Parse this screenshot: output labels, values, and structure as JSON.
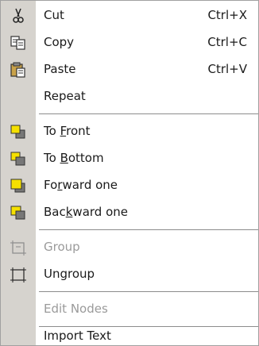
{
  "menu": {
    "items": [
      {
        "label": "Cut",
        "shortcut": "Ctrl+X",
        "icon": "scissors-icon",
        "enabled": true
      },
      {
        "label": "Copy",
        "shortcut": "Ctrl+C",
        "icon": "copy-icon",
        "enabled": true
      },
      {
        "label": "Paste",
        "shortcut": "Ctrl+V",
        "icon": "paste-icon",
        "enabled": true
      },
      {
        "label": "Repeat",
        "shortcut": "",
        "icon": "",
        "enabled": true
      },
      {
        "label_pre": "To ",
        "label_acc": "F",
        "label_post": "ront",
        "icon": "to-front-icon",
        "enabled": true
      },
      {
        "label_pre": "To ",
        "label_acc": "B",
        "label_post": "ottom",
        "icon": "to-bottom-icon",
        "enabled": true
      },
      {
        "label_pre": "Fo",
        "label_acc": "r",
        "label_post": "ward one",
        "icon": "forward-one-icon",
        "enabled": true
      },
      {
        "label_pre": "Bac",
        "label_acc": "k",
        "label_post": "ward one",
        "icon": "backward-one-icon",
        "enabled": true
      },
      {
        "label": "Group",
        "icon": "group-icon",
        "enabled": false
      },
      {
        "label": "Ungroup",
        "icon": "ungroup-icon",
        "enabled": true
      },
      {
        "label": "Edit Nodes",
        "icon": "",
        "enabled": false
      },
      {
        "label": "Import Text",
        "icon": "",
        "enabled": true
      }
    ]
  }
}
